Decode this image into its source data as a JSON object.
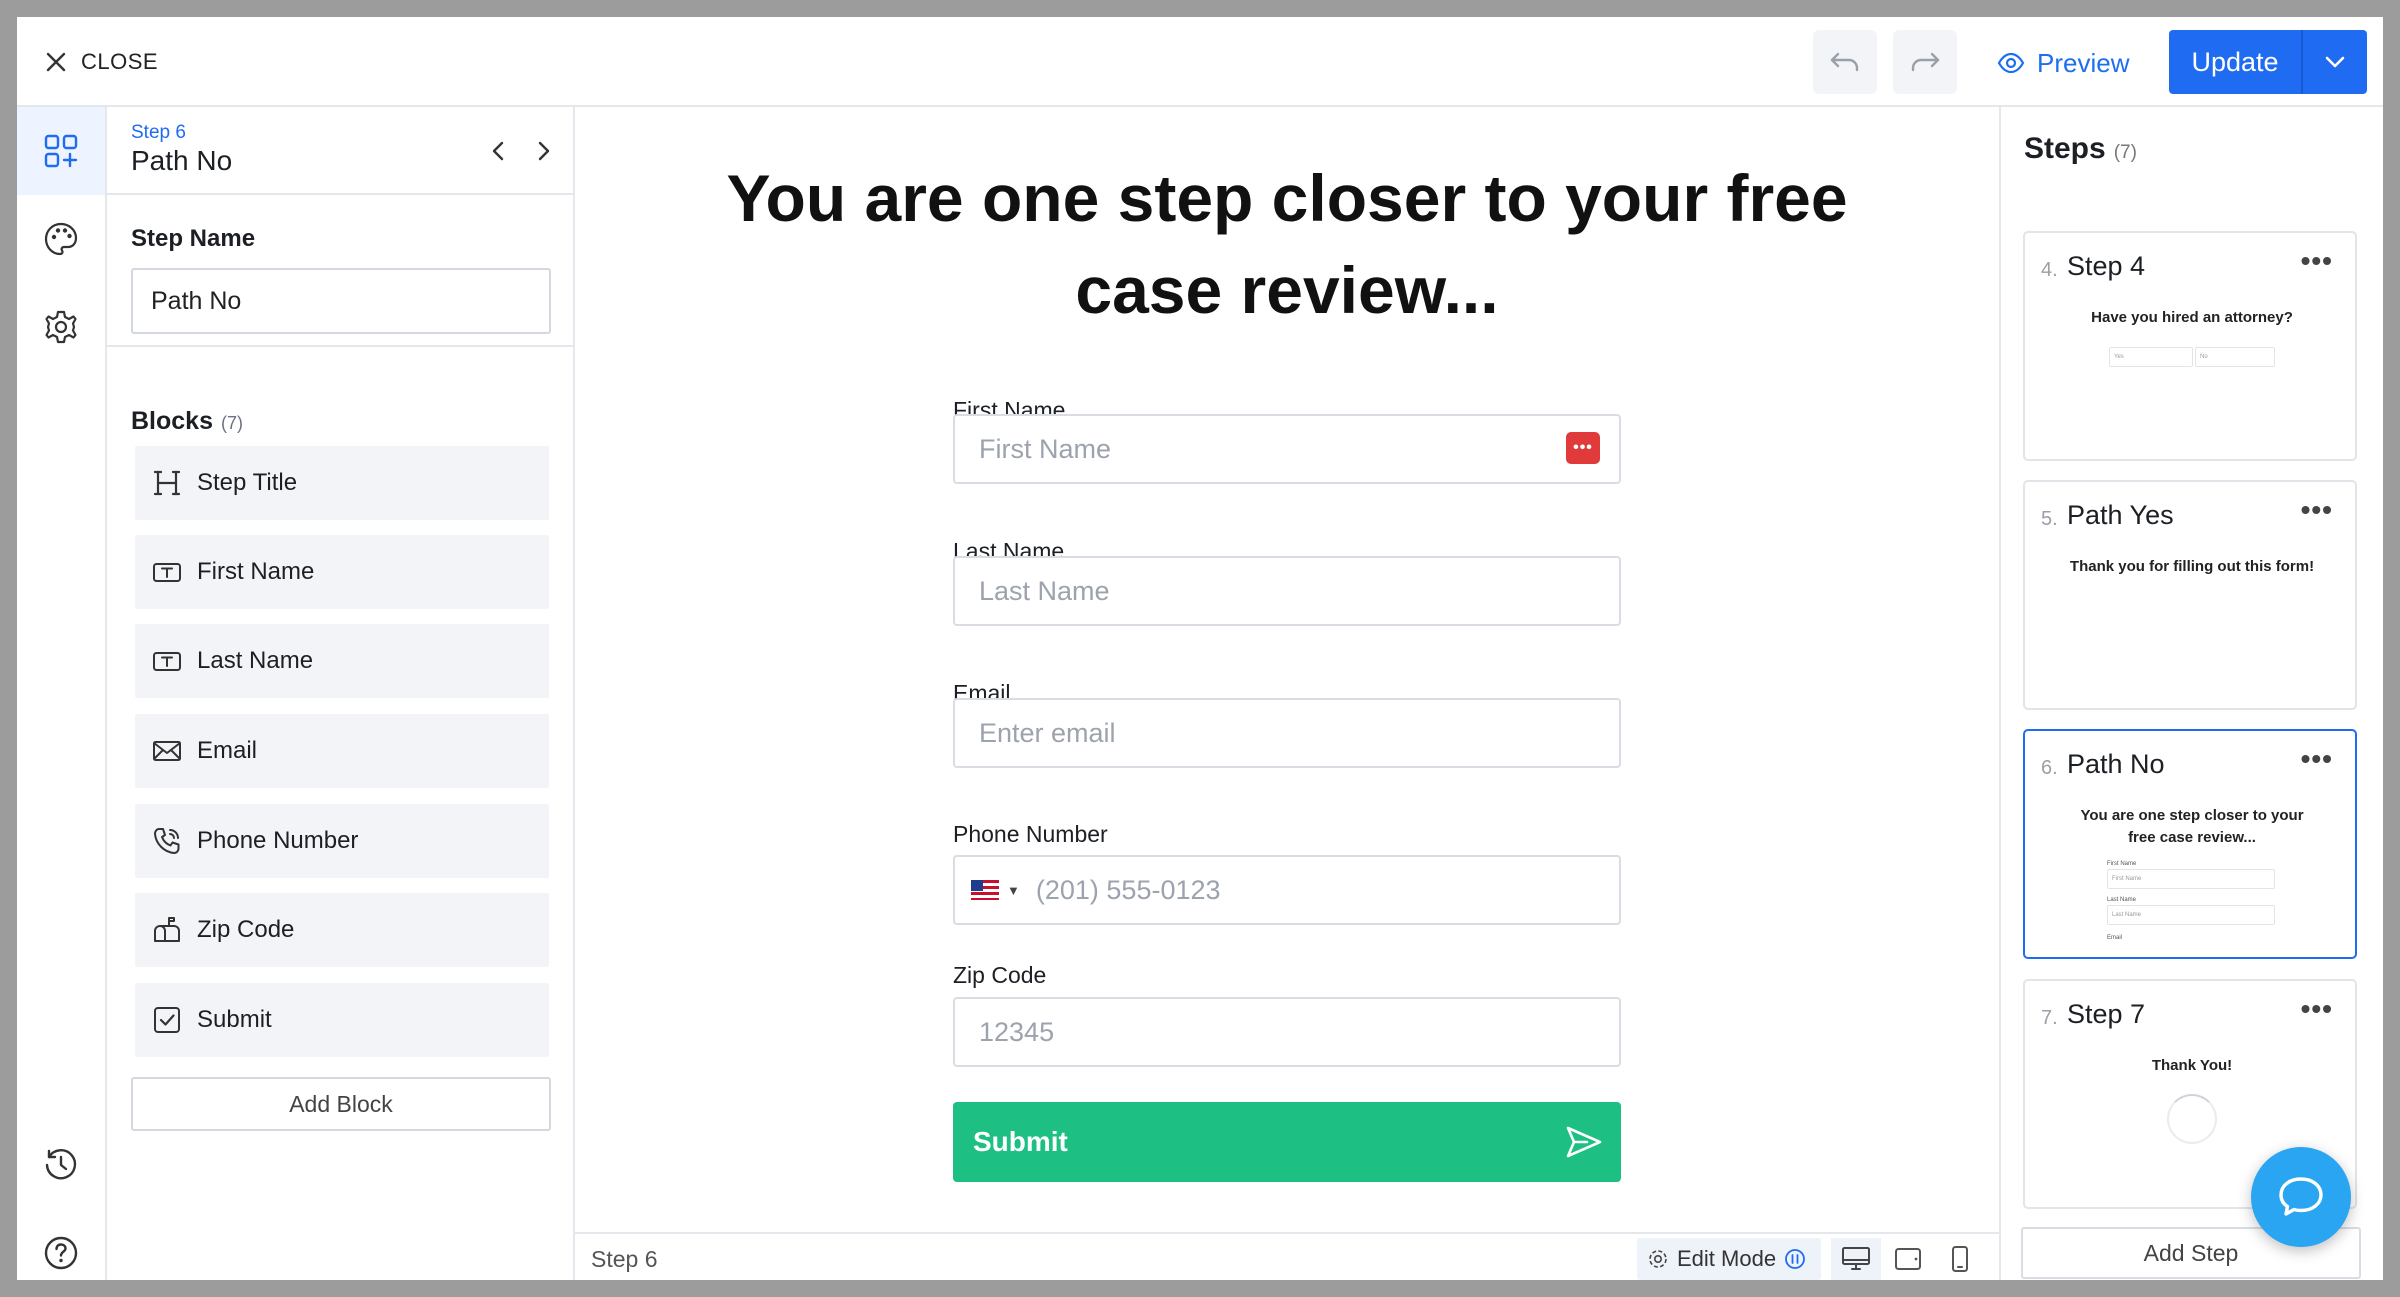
{
  "topbar": {
    "close_label": "CLOSE",
    "preview_label": "Preview",
    "update_label": "Update"
  },
  "left_panel": {
    "step_label": "Step 6",
    "step_title": "Path No",
    "step_name_heading": "Step Name",
    "step_name_value": "Path No",
    "blocks_heading": "Blocks",
    "blocks_count": "(7)",
    "blocks": [
      {
        "label": "Step Title",
        "icon": "heading-icon"
      },
      {
        "label": "First Name",
        "icon": "text-field-icon"
      },
      {
        "label": "Last Name",
        "icon": "text-field-icon"
      },
      {
        "label": "Email",
        "icon": "mail-icon"
      },
      {
        "label": "Phone Number",
        "icon": "phone-icon"
      },
      {
        "label": "Zip Code",
        "icon": "mailbox-icon"
      },
      {
        "label": "Submit",
        "icon": "checkbox-icon"
      }
    ],
    "add_block_label": "Add Block"
  },
  "form": {
    "title": "You are one step closer to your free case review...",
    "fields": {
      "first_name": {
        "label": "First Name",
        "placeholder": "First Name"
      },
      "last_name": {
        "label": "Last Name",
        "placeholder": "Last Name"
      },
      "email": {
        "label": "Email",
        "placeholder": "Enter email"
      },
      "phone": {
        "label": "Phone Number",
        "placeholder": "(201) 555-0123"
      },
      "zip": {
        "label": "Zip Code",
        "placeholder": "12345"
      }
    },
    "submit_label": "Submit"
  },
  "canvas_footer": {
    "step_label": "Step 6",
    "edit_mode_label": "Edit Mode"
  },
  "right_panel": {
    "heading": "Steps",
    "count": "(7)",
    "steps": [
      {
        "num": "4.",
        "name": "Step 4",
        "preview_title": "Have you hired an attorney?",
        "options": [
          "Yes",
          "No"
        ]
      },
      {
        "num": "5.",
        "name": "Path Yes",
        "preview_title": "Thank you for filling out this form!"
      },
      {
        "num": "6.",
        "name": "Path No",
        "preview_title": "You are one step closer to your free case review...",
        "mini_fields": [
          {
            "label": "First Name",
            "placeholder": "First Name"
          },
          {
            "label": "Last Name",
            "placeholder": "Last Name"
          },
          {
            "label": "Email"
          }
        ]
      },
      {
        "num": "7.",
        "name": "Step 7",
        "preview_title": "Thank You!"
      }
    ],
    "add_step_label": "Add Step"
  },
  "colors": {
    "accent": "#1f6bf2",
    "submit": "#1dbf83",
    "chat": "#2aa5f2",
    "password_badge": "#e03a3a"
  }
}
